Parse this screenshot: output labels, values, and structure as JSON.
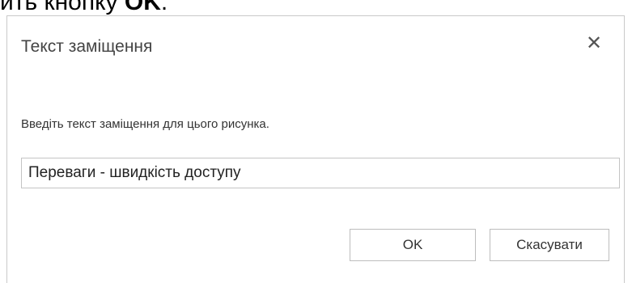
{
  "instruction": {
    "prefix": "ить кнопку",
    "emphasis": "OK",
    "suffix": "."
  },
  "dialog": {
    "title": "Текст заміщення",
    "close_symbol": "✕",
    "prompt": "Введіть текст заміщення для цього рисунка.",
    "input_value": "Переваги - швидкість доступу",
    "ok_label": "OK",
    "cancel_label": "Скасувати"
  },
  "icons": {
    "close": "close-icon"
  }
}
